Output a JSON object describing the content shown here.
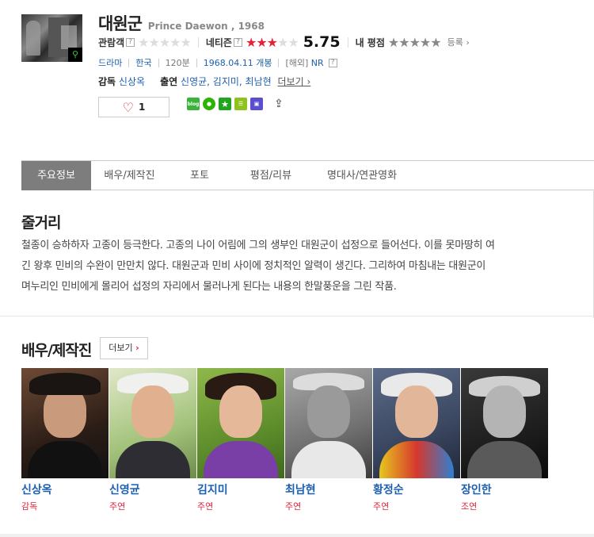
{
  "movie": {
    "title_ko": "대원군",
    "title_en": "Prince Daewon , 1968",
    "poster_zoom_icon": "search-icon"
  },
  "ratings": {
    "audience_label": "관람객",
    "audience_stars": 0,
    "netizen_label": "네티즌",
    "netizen_stars": 3,
    "netizen_score": "5.75",
    "my_label": "내 평점",
    "register_label": "등록",
    "help_mark": "?"
  },
  "meta": {
    "genre": "드라마",
    "country": "한국",
    "runtime": "120분",
    "release": "1968.04.11 개봉",
    "grade_prefix": "[해외]",
    "grade": "NR",
    "help_mark": "?"
  },
  "credits": {
    "director_label": "감독",
    "director": "신상옥",
    "cast_label": "출연",
    "cast": "신영균, 김지미, 최남현",
    "more_label": "더보기"
  },
  "like": {
    "count": "1"
  },
  "share": {
    "blog_label": "blog",
    "icons": [
      "blog-icon",
      "talk-icon",
      "star-icon",
      "list-icon",
      "bookmark-icon",
      "share-icon"
    ]
  },
  "tabs": [
    {
      "label": "주요정보",
      "active": true
    },
    {
      "label": "배우/제작진",
      "active": false
    },
    {
      "label": "포토",
      "active": false
    },
    {
      "label": "평점/리뷰",
      "active": false
    },
    {
      "label": "명대사/연관영화",
      "active": false
    }
  ],
  "synopsis": {
    "title": "줄거리",
    "lines": [
      "철종이 승하하자 고종이 등극한다. 고종의 나이 어림에 그의 생부인 대원군이 섭정으로 들어선다. 이를 못마땅히 여",
      "긴 왕후 민비의 수완이 만만치 않다. 대원군과 민비 사이에 정치적인 알력이 생긴다. 그리하여 마침내는 대원군이",
      "며누리인 민비에게 몰리어 섭정의 자리에서 물러나게 된다는 내용의 한말풍운을 그린 작품."
    ]
  },
  "cast_section": {
    "title": "배우/제작진",
    "more_label": "더보기",
    "people": [
      {
        "name": "신상옥",
        "role": "감독"
      },
      {
        "name": "신영균",
        "role": "주연"
      },
      {
        "name": "김지미",
        "role": "주연"
      },
      {
        "name": "최남현",
        "role": "주연"
      },
      {
        "name": "황정순",
        "role": "주연"
      },
      {
        "name": "장인한",
        "role": "조연"
      }
    ]
  },
  "colors": {
    "accent_red": "#e1243a",
    "link_blue": "#1c5fb0",
    "tab_active_bg": "#7d7d7d"
  }
}
